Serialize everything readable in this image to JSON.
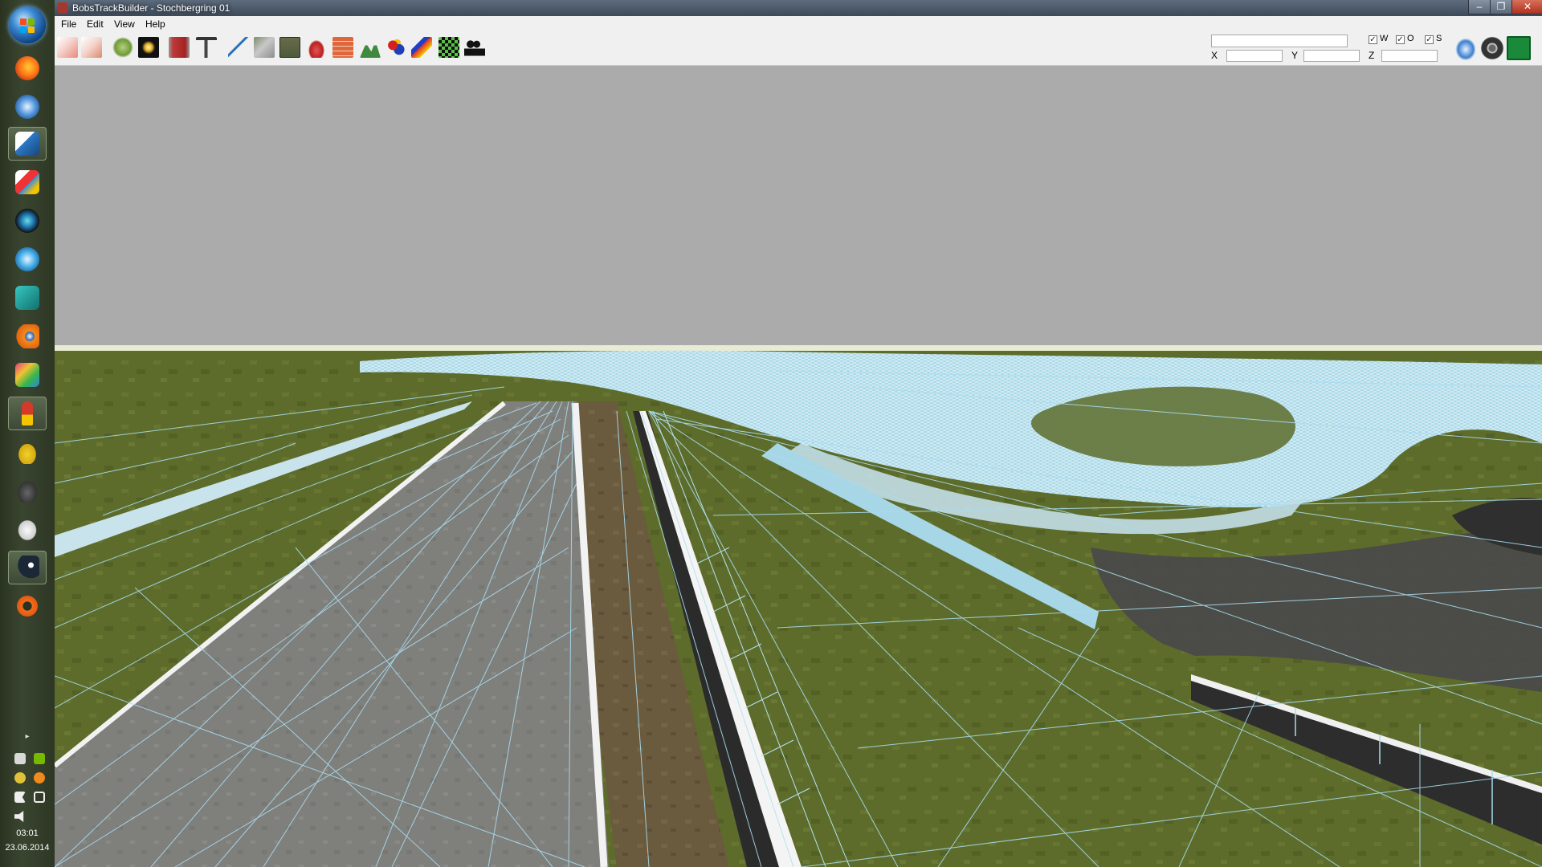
{
  "window": {
    "title": "BobsTrackBuilder - Stochbergring 01",
    "controls": [
      "minimize",
      "restore",
      "close"
    ]
  },
  "menu": {
    "items": [
      {
        "label": "File"
      },
      {
        "label": "Edit"
      },
      {
        "label": "View"
      },
      {
        "label": "Help"
      }
    ]
  },
  "toolbar": {
    "tools": [
      "path-tool-icon",
      "path-edit-icon",
      "terrain-icon",
      "sun-icon",
      "wall-icon",
      "tree-icon",
      "spline-icon",
      "road-icon",
      "grid-icon",
      "car-icon",
      "brick-icon",
      "mountain-icon",
      "objects-icon",
      "paint-icon",
      "checkered-flag-icon",
      "camera-icon"
    ],
    "coords": {
      "x_label": "X",
      "y_label": "Y",
      "z_label": "Z",
      "x_value": "",
      "y_value": "",
      "z_value": "",
      "top_value": ""
    },
    "toggles": [
      {
        "label": "W",
        "checked": true
      },
      {
        "label": "O",
        "checked": true
      },
      {
        "label": "S",
        "checked": true
      }
    ],
    "right_buttons": [
      "helicopter-view-icon",
      "steering-wheel-icon",
      "walk-icon"
    ]
  },
  "taskbar": {
    "apps": [
      "firefox-icon",
      "thunderbird-icon",
      "inkscape-icon",
      "paint-app-icon",
      "media-player-icon",
      "video-icon",
      "maya-icon",
      "blender-icon",
      "image-editor-icon",
      "track-builder-icon",
      "racing-game-icon",
      "gamepad-icon",
      "game-controller-icon",
      "steam-icon",
      "origin-icon"
    ],
    "clock_time": "03:01",
    "clock_date": "23.06.2014"
  },
  "colors": {
    "sky": "#ababab",
    "horizon": "#e8ebd2",
    "grass": "#5c6b2a",
    "road": "#7f7f7d",
    "wire": "#9ed4e8",
    "water": "#a8d8e8",
    "asphalt": "#3a3a3a"
  }
}
